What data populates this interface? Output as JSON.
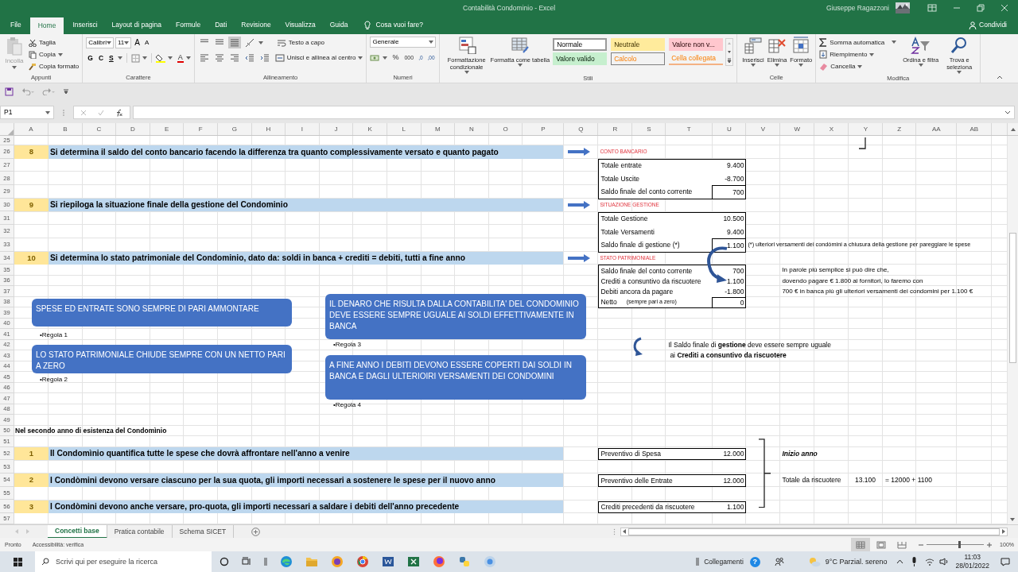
{
  "window": {
    "title": "Contabilità Condominio  -  Excel",
    "user": "Giuseppe Ragazzoni",
    "share": "Condividi"
  },
  "ribbon_tabs": [
    {
      "label": "File",
      "selected": false
    },
    {
      "label": "Home",
      "selected": true
    },
    {
      "label": "Inserisci",
      "selected": false
    },
    {
      "label": "Layout di pagina",
      "selected": false
    },
    {
      "label": "Formule",
      "selected": false
    },
    {
      "label": "Dati",
      "selected": false
    },
    {
      "label": "Revisione",
      "selected": false
    },
    {
      "label": "Visualizza",
      "selected": false
    },
    {
      "label": "Guida",
      "selected": false
    }
  ],
  "tell_me": "Cosa vuoi fare?",
  "ribbon": {
    "clipboard": {
      "label": "Appunti",
      "paste": {
        "label": "Incolla",
        "disabled": true
      },
      "cut": "Taglia",
      "copy": "Copia",
      "format_painter": "Copia formato"
    },
    "font": {
      "label": "Carattere",
      "name": "Calibri",
      "size": "11",
      "grow": "A",
      "shrink": "A",
      "bold": "G",
      "italic": "C",
      "underline": "S",
      "font_color": "A"
    },
    "alignment": {
      "label": "Allineamento",
      "wrap": "Testo a capo",
      "merge": "Unisci e allinea al centro"
    },
    "number": {
      "label": "Numeri",
      "format": "Generale",
      "percent": "%",
      "thousands": "000",
      "decimals": [
        ",0",
        ",00"
      ]
    },
    "styles": {
      "label": "Stili",
      "conditional": "Formattazione condizionale",
      "as_table": "Formatta come tabella",
      "cells": [
        {
          "label": "Normale",
          "color": "#ffffff",
          "kind": "selected"
        },
        {
          "label": "Neutrale",
          "color": "#ffeb9c",
          "kind": "plain"
        },
        {
          "label": "Valore non v...",
          "color": "#ffc7ce",
          "kind": "plain"
        },
        {
          "label": "Valore valido",
          "color": "#c6efce",
          "kind": "plain"
        },
        {
          "label": "Calcolo",
          "color": "#f2f2f2",
          "kind": "boxed"
        },
        {
          "label": "Cella collegata",
          "color": "#f3f3f3",
          "kind": "underlined"
        }
      ]
    },
    "cells": {
      "label": "Celle",
      "buttons": [
        "Inserisci",
        "Elimina",
        "Formato"
      ]
    },
    "editing": {
      "label": "Modifica",
      "autosum": "Somma automatica",
      "fill": "Riempimento",
      "clear": "Cancella",
      "sort": "Ordina e filtra",
      "find": "Trova e seleziona"
    }
  },
  "name_box": "P1",
  "columns": [
    "A",
    "B",
    "C",
    "D",
    "E",
    "F",
    "G",
    "H",
    "I",
    "J",
    "K",
    "L",
    "M",
    "N",
    "O",
    "P",
    "Q",
    "R",
    "S",
    "T",
    "U",
    "V",
    "W",
    "X",
    "Y",
    "Z",
    "AA",
    "AB"
  ],
  "rows": [
    "25",
    "26",
    "27",
    "28",
    "29",
    "30",
    "31",
    "32",
    "33",
    "34",
    "35",
    "36",
    "37",
    "38",
    "39",
    "40",
    "41",
    "42",
    "43",
    "44",
    "45",
    "46",
    "47",
    "48",
    "49",
    "50",
    "51",
    "52",
    "53",
    "54",
    "55",
    "56",
    "57"
  ],
  "steps": [
    {
      "number": "8",
      "text": "Si determina il saldo del conto bancario facendo la differenza tra quanto complessivamente versato e quanto pagato"
    },
    {
      "number": "9",
      "text": "Si riepiloga la situazione finale della gestione del Condominio"
    },
    {
      "number": "10",
      "text": "Si determina lo stato patrimoniale del Condominio, dato da: soldi in banca + crediti = debiti,  tutti a fine anno"
    }
  ],
  "tables": [
    {
      "title": "CONTO BANCARIO",
      "rows": [
        {
          "label": "Totale entrate",
          "value": "9.400",
          "boxed": false
        },
        {
          "label": "Totale Uscite",
          "value": "-8.700",
          "boxed": false
        },
        {
          "label": "Saldo finale del conto corrente",
          "value": "700",
          "boxed": true
        }
      ]
    },
    {
      "title": "SITUAZIONE GESTIONE",
      "rows": [
        {
          "label": "Totale Gestione",
          "value": "10.500",
          "boxed": false
        },
        {
          "label": "Totale Versamenti",
          "value": "9.400",
          "boxed": false
        },
        {
          "label": "Saldo finale di gestione (*)",
          "value": "1.100",
          "boxed": true
        }
      ]
    },
    {
      "title": "STATO PATRIMONIALE",
      "rows": [
        {
          "label": "Saldo finale del conto corrente",
          "value": "700",
          "boxed": false
        },
        {
          "label": "Crediti a consuntivo da riscuotere",
          "value": "1.100",
          "boxed": false
        },
        {
          "label": "Debiti ancora da pagare",
          "value": "-1.800",
          "boxed": false
        },
        {
          "label": "Netto",
          "note": "(sempre pari a zero)",
          "value": "0",
          "boxed": true
        }
      ]
    }
  ],
  "footnote": "(*) ulteriori versamenti dei condòmini a chiusura della gestione per pareggiare le spese",
  "explanation": [
    "In parole più semplice si può dire che,",
    "dovendo pagare € 1.800 ai fornitori, lo faremo con",
    "700 € in banca più gli ulteriori versamenti dei condomini per 1.100 €"
  ],
  "rules": [
    {
      "text": "SPESE ED ENTRATE SONO SEMPRE DI PARI AMMONTARE",
      "caption": "•Regola 1"
    },
    {
      "text": "LO STATO PATRIMONIALE CHIUDE SEMPRE CON UN NETTO PARI A ZERO",
      "caption": "•Regola 2"
    },
    {
      "text": "IL DENARO CHE RISULTA DALLA CONTABILITA' DEL CONDOMINIO DEVE ESSERE SEMPRE UGUALE AI SOLDI EFFETTIVAMENTE IN BANCA",
      "caption": "•Regola 3"
    },
    {
      "text": "A FINE ANNO I DEBITI DEVONO ESSERE COPERTI DAI SOLDI IN BANCA E DAGLI ULTERIOIRI VERSAMENTI DEI CONDOMINI",
      "caption": "•Regola 4"
    }
  ],
  "remark": [
    "Il Saldo finale di **gestione** deve essere sempre uguale",
    "ai **Crediti a consuntivo da riscuotere**"
  ],
  "section_heading": "Nel secondo anno di esistenza del Condomìnio",
  "second_year_steps": [
    {
      "number": "1",
      "text": "Il Condomìnio quantifica tutte le spese che dovrà affrontare nell'anno a venire"
    },
    {
      "number": "2",
      "text": "I Condòmini devono versare ciascuno per la sua quota, gli importi necessari a sostenere le spese per il nuovo anno"
    },
    {
      "number": "3",
      "text": "I Condòmini devono anche versare, pro-quota, gli importi necessari a saldare i debiti dell'anno precedente"
    }
  ],
  "budget": {
    "rows": [
      {
        "label": "Preventivo di Spesa",
        "value": "12.000"
      },
      {
        "label": "Preventivo delle Entrate",
        "value": "12.000"
      },
      {
        "label": "Crediti precedenti da riscuotere",
        "value": "1.100"
      }
    ],
    "period": "Inizio anno",
    "total_label": "Totale da riscuotere",
    "total_value": "13.100",
    "formula": "= 12000 + 1100"
  },
  "sheet_tabs": [
    {
      "label": "Concetti base",
      "selected": true
    },
    {
      "label": "Pratica contabile",
      "selected": false
    },
    {
      "label": "Schema SICET",
      "selected": false
    }
  ],
  "status": [
    "Pronto",
    "Accessibilità: verifica"
  ],
  "views": [
    {
      "kind": "normal",
      "selected": true
    },
    {
      "kind": "page_layout",
      "selected": false
    },
    {
      "kind": "page_break",
      "selected": false
    }
  ],
  "zoom": {
    "label": "100%",
    "level": 0.55
  },
  "taskbar": {
    "search_placeholder": "Scrivi qui per eseguire la ricerca",
    "links": "Collegamenti",
    "help": "?",
    "weather": "9°C  Parzial. sereno",
    "time": "11:03",
    "date": "28/01/2022"
  }
}
